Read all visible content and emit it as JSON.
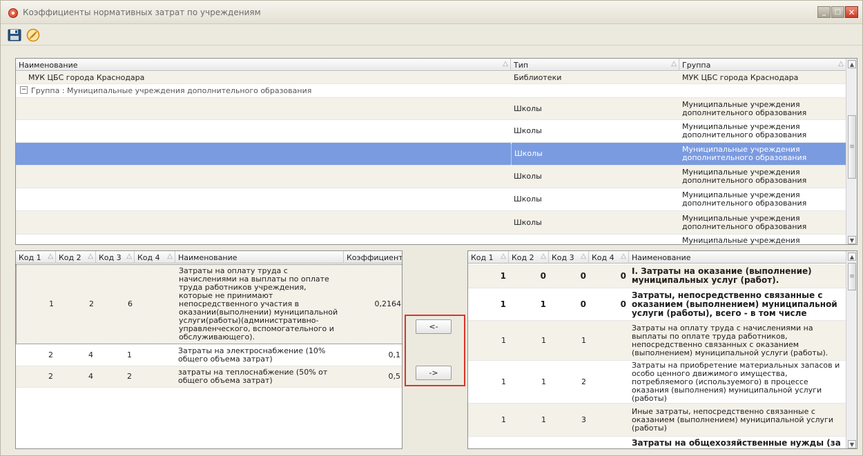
{
  "window": {
    "title": "Коэффициенты нормативных затрат по учреждениям",
    "min_label": "_",
    "max_label": "□",
    "close_label": "✕"
  },
  "toolbar": {
    "save_icon": "floppy-disk-icon",
    "cancel_icon": "cancel-edit-icon"
  },
  "top_grid": {
    "columns": [
      "Наименование",
      "Тип",
      "Группа"
    ],
    "sort_glyph": "△",
    "rows": [
      {
        "name": "МУК ЦБС города Краснодара",
        "type": "Библиотеки",
        "group": "МУК ЦБС города Краснодара"
      },
      {
        "group_header": "Группа : Муниципальные учреждения дополнительного образования"
      },
      {
        "name": "",
        "type": "Школы",
        "group": "Муниципальные учреждения дополнительного образования"
      },
      {
        "name": "",
        "type": "Школы",
        "group": "Муниципальные учреждения дополнительного образования"
      },
      {
        "name": "",
        "type": "Школы",
        "group": "Муниципальные учреждения дополнительного образования",
        "selected": true
      },
      {
        "name": "",
        "type": "Школы",
        "group": "Муниципальные учреждения дополнительного образования"
      },
      {
        "name": "",
        "type": "Школы",
        "group": "Муниципальные учреждения дополнительного образования"
      },
      {
        "name": "",
        "type": "Школы",
        "group": "Муниципальные учреждения дополнительного образования"
      },
      {
        "name": "",
        "type": "",
        "group": "Муниципальные учреждения"
      }
    ]
  },
  "left_grid": {
    "columns": [
      "Код 1",
      "Код 2",
      "Код 3",
      "Код 4",
      "Наименование",
      "Коэффициент"
    ],
    "rows": [
      {
        "k1": "1",
        "k2": "2",
        "k3": "6",
        "k4": "",
        "name": "Затраты на оплату труда с начислениями на выплаты по оплате труда работников учреждения, которые не принимают непосредственного участия в оказании(выполнении) муниципальной услуги(работы)(административно-управленческого, вспомогательного и обслуживающего).",
        "coef": "0,2164"
      },
      {
        "k1": "2",
        "k2": "4",
        "k3": "1",
        "k4": "",
        "name": "Затраты на электроснабжение (10% общего объема затрат)",
        "coef": "0,1"
      },
      {
        "k1": "2",
        "k2": "4",
        "k3": "2",
        "k4": "",
        "name": "затраты на теплоснабжение (50% от общего объема затрат)",
        "coef": "0,5"
      }
    ]
  },
  "move_buttons": {
    "left_label": "<-",
    "right_label": "->"
  },
  "right_grid": {
    "columns": [
      "Код 1",
      "Код 2",
      "Код 3",
      "Код 4",
      "Наименование"
    ],
    "rows": [
      {
        "k1": "1",
        "k2": "0",
        "k3": "0",
        "k4": "0",
        "name": "I. Затраты на оказание (выполнение) муниципальных услуг (работ).",
        "bold": true
      },
      {
        "k1": "1",
        "k2": "1",
        "k3": "0",
        "k4": "0",
        "name": "Затраты, непосредственно связанные с оказанием (выполнением) муниципальной услуги (работы), всего - в том числе",
        "bold": true
      },
      {
        "k1": "1",
        "k2": "1",
        "k3": "1",
        "k4": "",
        "name": "Затраты на оплату труда с начислениями на выплаты по оплате труда работников, непосредственно связанных с оказанием (выполнением) муниципальной услуги (работы)."
      },
      {
        "k1": "1",
        "k2": "1",
        "k3": "2",
        "k4": "",
        "name": "Затраты на приобретение материальных запасов и особо ценного движимого имущества, потребляемого (используемого) в процессе оказания (выполнения) муниципальной услуги (работы)"
      },
      {
        "k1": "1",
        "k2": "1",
        "k3": "3",
        "k4": "",
        "name": "Иные затраты, непосредственно связанные с оказанием (выполнением) муниципальной услуги (работы)"
      },
      {
        "k1": "",
        "k2": "",
        "k3": "",
        "k4": "",
        "name": "Затраты на общехозяйственные нужды (за",
        "bold": true
      }
    ]
  }
}
